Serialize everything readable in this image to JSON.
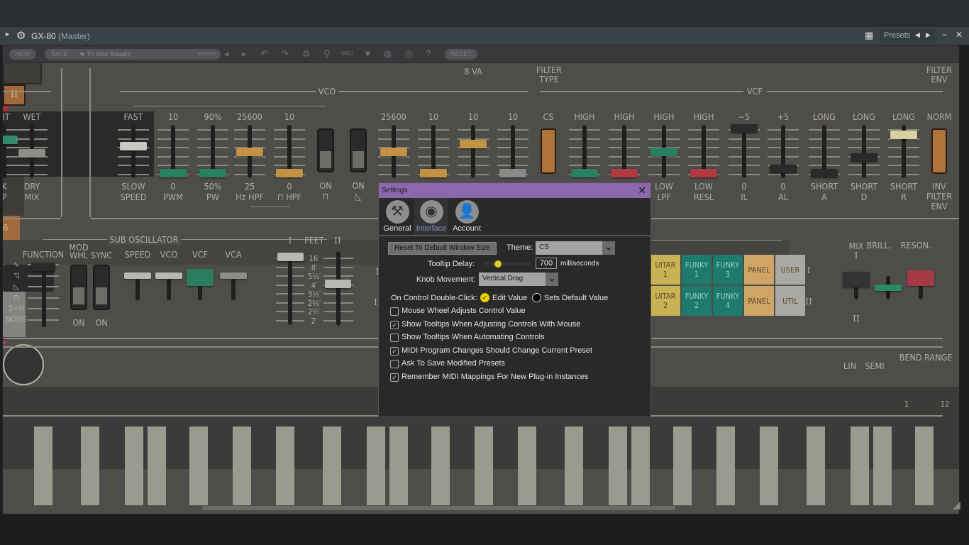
{
  "window": {
    "title": "GX-80",
    "subtitle": "(Master)",
    "presets_label": "Presets",
    "prev": "◀",
    "next": "▶",
    "minimize": "−",
    "close": "✕",
    "grid_icon": "grid-icon"
  },
  "toolbar": {
    "new": "NEW",
    "save": "SAVE",
    "preset_name": "Tri Sine Beauty",
    "edited": "EDITED",
    "reset": "RESET",
    "midi": "MIDI"
  },
  "synth": {
    "top_cut_labels": [
      "8 VA",
      "FILTER",
      "TYPE",
      "FILTER",
      "ENV"
    ],
    "sections": {
      "vco": "VCO",
      "vcf": "VCF",
      "sub_osc": "SUB OSCILLATOR",
      "feet": "FEET"
    },
    "sliders": [
      {
        "top": "HT",
        "bottom": [
          "K",
          "P"
        ],
        "value": 0.75,
        "color": "#2e8a6a"
      },
      {
        "top": "WET",
        "bottom": [
          "DRY",
          "MIX"
        ],
        "value": 0.45,
        "color": "#8e8d88"
      },
      {
        "top": "FAST",
        "bottom": [
          "SLOW",
          "SPEED"
        ],
        "value": 0.6,
        "color": "#c9c8c2"
      },
      {
        "top": "10",
        "bottom": [
          "0",
          "PWM"
        ],
        "value": 0,
        "color": "#2a8062"
      },
      {
        "top": "90%",
        "bottom": [
          "50%",
          "PW"
        ],
        "value": 0,
        "color": "#2a8062"
      },
      {
        "top": "25600",
        "bottom": [
          "25",
          "Hz HPF"
        ],
        "value": 0.48,
        "color": "#c49243"
      },
      {
        "top": "10",
        "bottom": [
          "0",
          "⊓ HPF"
        ],
        "value": 0,
        "color": "#c49243"
      },
      {
        "top": "25600",
        "bottom": [
          "",
          ""
        ],
        "value": 0.48,
        "color": "#c49243"
      },
      {
        "top": "10",
        "bottom": [
          "",
          ""
        ],
        "value": 0,
        "color": "#c49243"
      },
      {
        "top": "10",
        "bottom": [
          "",
          ""
        ],
        "value": 0.65,
        "color": "#c49243"
      },
      {
        "top": "10",
        "bottom": [
          "",
          ""
        ],
        "value": 0,
        "color": "#8a8a88"
      },
      {
        "top": "HIGH",
        "bottom": [
          "",
          ""
        ],
        "value": 0,
        "color": "#2a8062"
      },
      {
        "top": "HIGH",
        "bottom": [
          "",
          ""
        ],
        "value": 0,
        "color": "#b03a40"
      },
      {
        "top": "HIGH",
        "bottom": [
          "LOW",
          "LPF"
        ],
        "value": 0.48,
        "color": "#2a8062"
      },
      {
        "top": "HIGH",
        "bottom": [
          "LOW",
          "RESL"
        ],
        "value": 0,
        "color": "#b03a40"
      },
      {
        "top": "−5",
        "bottom": [
          "0",
          "IL"
        ],
        "value": 1,
        "color": "#2a2a2a"
      },
      {
        "top": "+5",
        "bottom": [
          "0",
          "AL"
        ],
        "value": 0.1,
        "color": "#2a2a2a"
      },
      {
        "top": "LONG",
        "bottom": [
          "SHORT",
          "A"
        ],
        "value": 0,
        "color": "#2a2a2a"
      },
      {
        "top": "LONG",
        "bottom": [
          "SHORT",
          "D"
        ],
        "value": 0.35,
        "color": "#2a2a2a"
      },
      {
        "top": "LONG",
        "bottom": [
          "SHORT",
          "R"
        ],
        "value": 0.85,
        "color": "#d9cfa0"
      }
    ],
    "toggles": [
      {
        "top": "ON",
        "bottom": "⊓"
      },
      {
        "top": "ON",
        "bottom": "◺"
      }
    ],
    "orange_toggles": [
      {
        "top": "CS",
        "bottom": ""
      },
      {
        "top": "NORM",
        "bottom": [
          "INV",
          "FILTER",
          "ENV"
        ]
      }
    ],
    "sub_osc": {
      "function": "FUNCTION",
      "mod_whl": [
        "MOD",
        "WHL"
      ],
      "sync": "SYNC",
      "speed": "SPEED",
      "vco": "VCO",
      "vcf": "VCF",
      "vca": "VCA",
      "on1": "ON",
      "on2": "ON",
      "waves": [
        "∿",
        "◹",
        "◺",
        "⊓",
        "S+H",
        "NOISE"
      ]
    },
    "feet": {
      "roman1": "I",
      "roman2": "II",
      "ticks": [
        "16′",
        "8′",
        "5⅓′",
        "4′",
        "3⅕′",
        "2⅔′",
        "2²⁄₇′",
        "2′"
      ]
    },
    "patch_buttons": [
      {
        "label": "UITAR\n1",
        "color": "#c8b254"
      },
      {
        "label": "FUNKY\n1",
        "color": "#1f7a6e"
      },
      {
        "label": "FUNKY\n3",
        "color": "#1f7a6e"
      },
      {
        "label": "PANEL",
        "color": "#cfa566"
      },
      {
        "label": "USER",
        "color": "#a9a8a5"
      },
      {
        "label": "UITAR\n2",
        "color": "#c8b254"
      },
      {
        "label": "FUNKY\n2",
        "color": "#1f7a6e"
      },
      {
        "label": "FUNKY\n4",
        "color": "#1f7a6e"
      },
      {
        "label": "PANEL",
        "color": "#cfa566"
      },
      {
        "label": "UTIL",
        "color": "#a9a8a5"
      }
    ],
    "row_labels": [
      "I",
      "II"
    ],
    "mix": {
      "mix": "MIX",
      "i": "I",
      "ii": "II",
      "brill": "BRILL.",
      "reson": "RESON."
    },
    "bend": {
      "lin": "LIN",
      "semi": "SEMI",
      "bend_range": "BEND RANGE",
      "min": "1",
      "max": "12",
      "value": 0.35
    },
    "left_button": "6",
    "mid_button": "II"
  },
  "settings": {
    "title": "Settings",
    "close": "✕",
    "tabs": [
      {
        "label": "General",
        "icon": "wrench-screwdriver-icon"
      },
      {
        "label": "Interface",
        "icon": "eye-icon",
        "active": true
      },
      {
        "label": "Account",
        "icon": "user-icon"
      }
    ],
    "reset_window": "Reset To Default Window Size",
    "theme_label": "Theme:",
    "theme_value": "CS",
    "tooltip_label": "Tooltip Delay:",
    "tooltip_value": "700",
    "tooltip_unit": "milliseconds",
    "tooltip_fraction": 0.3,
    "knob_label": "Knob Movement:",
    "knob_value": "Vertical Drag",
    "dbl_label": "On Control Double-Click:",
    "dbl_opt1": "Edit Value",
    "dbl_opt2": "Sets Default Value",
    "dbl_selected": "Edit Value",
    "checkboxes": [
      {
        "label": "Mouse Wheel Adjusts Control Value",
        "checked": false
      },
      {
        "label": "Show Tooltips When Adjusting Controls With Mouse",
        "checked": true
      },
      {
        "label": "Show Tooltips When Automating Controls",
        "checked": false
      },
      {
        "label": "MIDI Program Changes Should Change Current Preset",
        "checked": true
      },
      {
        "label": "Ask To Save Modified Presets",
        "checked": false
      },
      {
        "label": "Remember MIDI Mappings For New Plug-in Instances",
        "checked": true
      }
    ],
    "accent": "#8b68ad",
    "radio_color": "#e8d000"
  }
}
